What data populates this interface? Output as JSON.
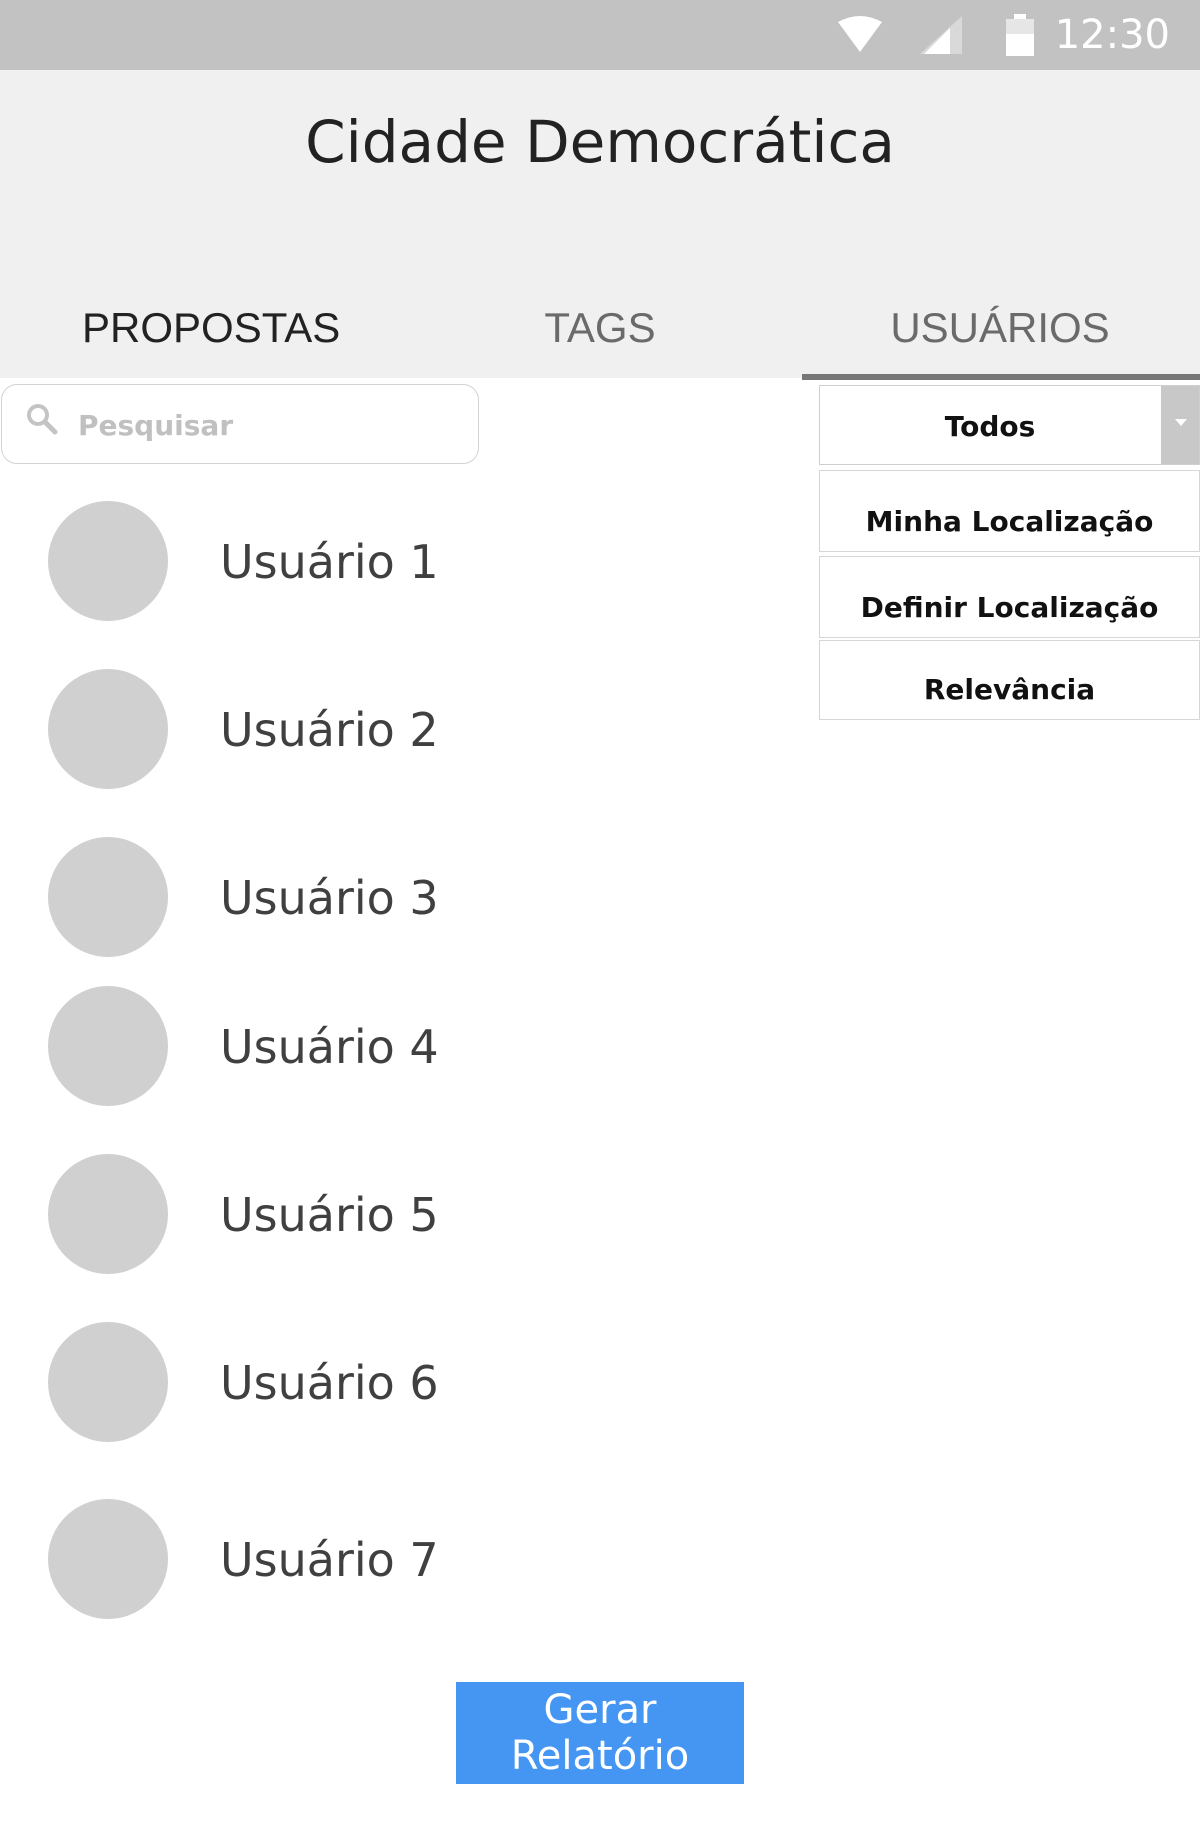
{
  "status_bar": {
    "time": "12:30",
    "icons": [
      "wifi-icon",
      "signal-icon",
      "battery-icon"
    ],
    "background": "#c2c2c2"
  },
  "header": {
    "title": "Cidade Democrática",
    "background": "#f0f0f0"
  },
  "tabs": [
    {
      "label": "PROPOSTAS",
      "active": false
    },
    {
      "label": "TAGS",
      "active": false
    },
    {
      "label": "USUÁRIOS",
      "active": true
    }
  ],
  "search": {
    "placeholder": "Pesquisar",
    "value": "",
    "icon": "search-icon"
  },
  "filter": {
    "selected": "Todos",
    "options": [
      "Minha Localização",
      "Definir Localização",
      "Relevância"
    ]
  },
  "users": [
    {
      "name": "Usuário 1"
    },
    {
      "name": "Usuário 2"
    },
    {
      "name": "Usuário 3"
    },
    {
      "name": "Usuário 4"
    },
    {
      "name": "Usuário 5"
    },
    {
      "name": "Usuário 6"
    },
    {
      "name": "Usuário 7"
    }
  ],
  "footer": {
    "report_button_label": "Gerar Relatório",
    "accent": "#4496f2"
  }
}
